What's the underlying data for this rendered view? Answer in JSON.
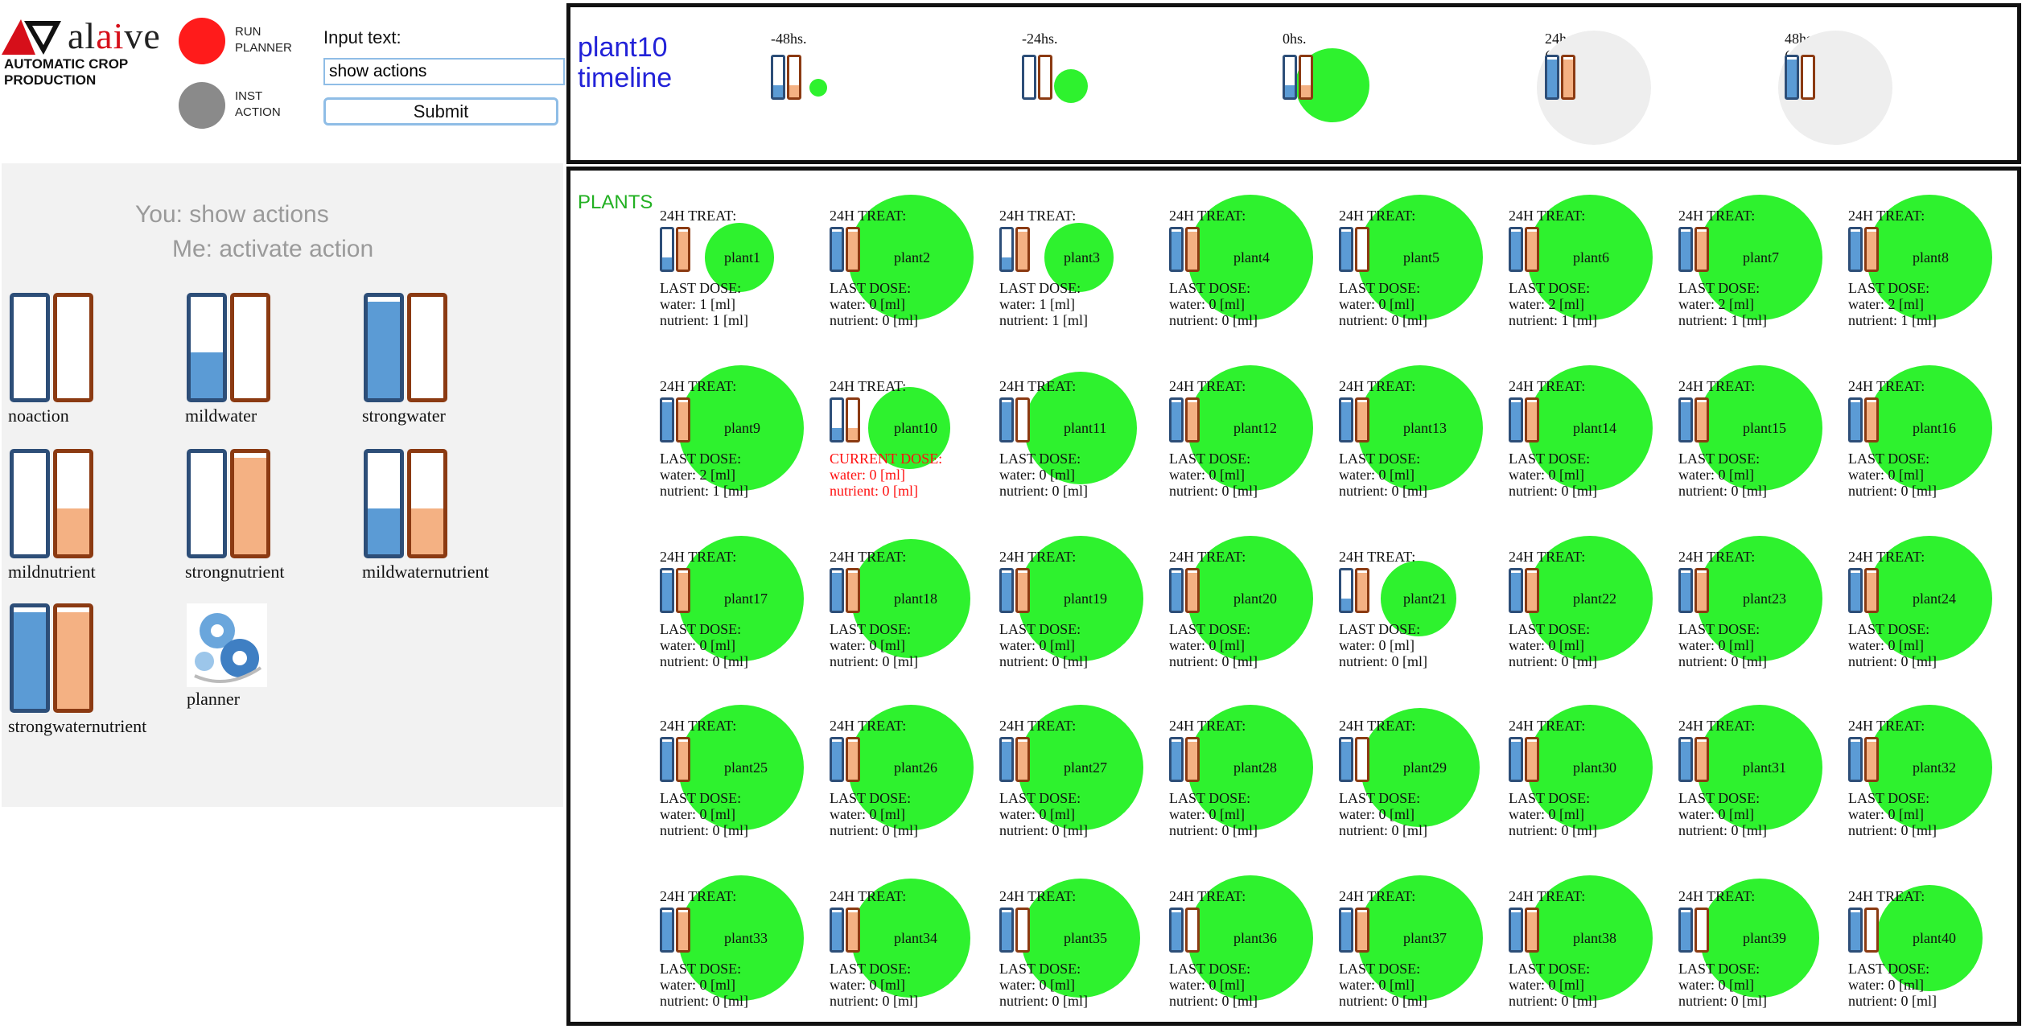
{
  "header": {
    "logo_text_a": "al",
    "logo_text_b": "ai",
    "logo_text_c": "ve",
    "subtitle_line1": "AUTOMATIC CROP",
    "subtitle_line2": "PRODUCTION",
    "run_planner_line1": "RUN",
    "run_planner_line2": "PLANNER",
    "inst_action_line1": "INST",
    "inst_action_line2": "ACTION",
    "input_label": "Input text:",
    "input_value": "show actions",
    "submit_label": "Submit"
  },
  "chat": {
    "you": "You: show actions",
    "me": "Me: activate action"
  },
  "colors": {
    "water": "#5b9bd5",
    "water_border": "#2d4e78",
    "nutrient": "#f4b183",
    "nutrient_border": "#8b3a12",
    "plant": "#2ef22e",
    "plan_circle": "#eeeeee",
    "run": "#ff1b1b",
    "inst": "#8a8a8a"
  },
  "actions": [
    {
      "label": "noaction",
      "water": 0,
      "nutrient": 0,
      "icon": "dual-gauge-icon"
    },
    {
      "label": "mildwater",
      "water": 0.45,
      "nutrient": 0,
      "icon": "dual-gauge-icon"
    },
    {
      "label": "strongwater",
      "water": 0.95,
      "nutrient": 0,
      "icon": "dual-gauge-icon"
    },
    {
      "label": "mildnutrient",
      "water": 0,
      "nutrient": 0.45,
      "icon": "dual-gauge-icon"
    },
    {
      "label": "strongnutrient",
      "water": 0,
      "nutrient": 0.95,
      "icon": "dual-gauge-icon"
    },
    {
      "label": "mildwaternutrient",
      "water": 0.45,
      "nutrient": 0.45,
      "icon": "dual-gauge-icon"
    },
    {
      "label": "strongwaternutrient",
      "water": 0.95,
      "nutrient": 0.95,
      "icon": "dual-gauge-icon"
    },
    {
      "label": "planner",
      "icon": "gears-icon"
    }
  ],
  "timeline": {
    "title_line1": "plant10",
    "title_line2": "timeline",
    "entries": [
      {
        "label": "-48hs.",
        "water": 0.3,
        "nutrient": 0.3,
        "size": 0.15,
        "plan": false
      },
      {
        "label": "-24hs.",
        "water": 0,
        "nutrient": 0,
        "size": 0.3,
        "plan": false
      },
      {
        "label": "0hs.",
        "water": 0.3,
        "nutrient": 0.3,
        "size": 0.65,
        "plan": false
      },
      {
        "label": "24hs. (plan)",
        "water": 0.95,
        "nutrient": 0.95,
        "size": 1.0,
        "plan": true
      },
      {
        "label": "48hs. (plan)",
        "water": 0.95,
        "nutrient": 0,
        "size": 1.0,
        "plan": true
      }
    ]
  },
  "plants_section": {
    "title": "PLANTS",
    "treat_label": "24H TREAT:",
    "last_dose_label": "LAST DOSE:",
    "current_dose_label": "CURRENT DOSE:",
    "water_prefix": "water: ",
    "nutrient_prefix": "nutrient: ",
    "unit": " [ml]"
  },
  "plants": [
    {
      "name": "plant1",
      "water": 1,
      "nutrient": 1,
      "treat_water": 0.3,
      "treat_nutrient": 0.95,
      "size": 0.55
    },
    {
      "name": "plant2",
      "water": 0,
      "nutrient": 0,
      "treat_water": 0.95,
      "treat_nutrient": 0.95,
      "size": 1.0
    },
    {
      "name": "plant3",
      "water": 1,
      "nutrient": 1,
      "treat_water": 0.3,
      "treat_nutrient": 0.95,
      "size": 0.55
    },
    {
      "name": "plant4",
      "water": 0,
      "nutrient": 0,
      "treat_water": 0.95,
      "treat_nutrient": 0.95,
      "size": 1.0
    },
    {
      "name": "plant5",
      "water": 0,
      "nutrient": 0,
      "treat_water": 0.95,
      "treat_nutrient": 0,
      "size": 1.0
    },
    {
      "name": "plant6",
      "water": 2,
      "nutrient": 1,
      "treat_water": 0.95,
      "treat_nutrient": 0.95,
      "size": 1.0
    },
    {
      "name": "plant7",
      "water": 2,
      "nutrient": 1,
      "treat_water": 0.95,
      "treat_nutrient": 0.95,
      "size": 1.0
    },
    {
      "name": "plant8",
      "water": 2,
      "nutrient": 1,
      "treat_water": 0.95,
      "treat_nutrient": 0.95,
      "size": 1.0
    },
    {
      "name": "plant9",
      "water": 2,
      "nutrient": 1,
      "treat_water": 0.95,
      "treat_nutrient": 0.95,
      "size": 1.0
    },
    {
      "name": "plant10",
      "water": 0,
      "nutrient": 0,
      "treat_water": 0.3,
      "treat_nutrient": 0.3,
      "size": 0.65,
      "current": true
    },
    {
      "name": "plant11",
      "water": 0,
      "nutrient": 0,
      "treat_water": 0.95,
      "treat_nutrient": 0,
      "size": 0.9
    },
    {
      "name": "plant12",
      "water": 0,
      "nutrient": 0,
      "treat_water": 0.95,
      "treat_nutrient": 0.95,
      "size": 1.0
    },
    {
      "name": "plant13",
      "water": 0,
      "nutrient": 0,
      "treat_water": 0.95,
      "treat_nutrient": 0.95,
      "size": 1.0
    },
    {
      "name": "plant14",
      "water": 0,
      "nutrient": 0,
      "treat_water": 0.95,
      "treat_nutrient": 0.95,
      "size": 1.0
    },
    {
      "name": "plant15",
      "water": 0,
      "nutrient": 0,
      "treat_water": 0.95,
      "treat_nutrient": 0.95,
      "size": 1.0
    },
    {
      "name": "plant16",
      "water": 0,
      "nutrient": 0,
      "treat_water": 0.95,
      "treat_nutrient": 0.95,
      "size": 1.0
    },
    {
      "name": "plant17",
      "water": 0,
      "nutrient": 0,
      "treat_water": 0.95,
      "treat_nutrient": 0.95,
      "size": 1.0
    },
    {
      "name": "plant18",
      "water": 0,
      "nutrient": 0,
      "treat_water": 0.95,
      "treat_nutrient": 0.95,
      "size": 0.95
    },
    {
      "name": "plant19",
      "water": 0,
      "nutrient": 0,
      "treat_water": 0.95,
      "treat_nutrient": 0.95,
      "size": 1.0
    },
    {
      "name": "plant20",
      "water": 0,
      "nutrient": 0,
      "treat_water": 0.95,
      "treat_nutrient": 0.95,
      "size": 1.0
    },
    {
      "name": "plant21",
      "water": 0,
      "nutrient": 0,
      "treat_water": 0.3,
      "treat_nutrient": 0.95,
      "size": 0.6
    },
    {
      "name": "plant22",
      "water": 0,
      "nutrient": 0,
      "treat_water": 0.95,
      "treat_nutrient": 0.95,
      "size": 1.0
    },
    {
      "name": "plant23",
      "water": 0,
      "nutrient": 0,
      "treat_water": 0.95,
      "treat_nutrient": 0.95,
      "size": 1.0
    },
    {
      "name": "plant24",
      "water": 0,
      "nutrient": 0,
      "treat_water": 0.95,
      "treat_nutrient": 0.95,
      "size": 1.0
    },
    {
      "name": "plant25",
      "water": 0,
      "nutrient": 0,
      "treat_water": 0.95,
      "treat_nutrient": 0.95,
      "size": 1.0
    },
    {
      "name": "plant26",
      "water": 0,
      "nutrient": 0,
      "treat_water": 0.95,
      "treat_nutrient": 0.95,
      "size": 1.0
    },
    {
      "name": "plant27",
      "water": 0,
      "nutrient": 0,
      "treat_water": 0.95,
      "treat_nutrient": 0.95,
      "size": 1.0
    },
    {
      "name": "plant28",
      "water": 0,
      "nutrient": 0,
      "treat_water": 0.95,
      "treat_nutrient": 0.95,
      "size": 1.0
    },
    {
      "name": "plant29",
      "water": 0,
      "nutrient": 0,
      "treat_water": 0.95,
      "treat_nutrient": 0,
      "size": 0.95
    },
    {
      "name": "plant30",
      "water": 0,
      "nutrient": 0,
      "treat_water": 0.95,
      "treat_nutrient": 0.95,
      "size": 1.0
    },
    {
      "name": "plant31",
      "water": 0,
      "nutrient": 0,
      "treat_water": 0.95,
      "treat_nutrient": 0.95,
      "size": 1.0
    },
    {
      "name": "plant32",
      "water": 0,
      "nutrient": 0,
      "treat_water": 0.95,
      "treat_nutrient": 0.95,
      "size": 1.0
    },
    {
      "name": "plant33",
      "water": 0,
      "nutrient": 0,
      "treat_water": 0.95,
      "treat_nutrient": 0.95,
      "size": 1.0
    },
    {
      "name": "plant34",
      "water": 0,
      "nutrient": 0,
      "treat_water": 0.95,
      "treat_nutrient": 0.95,
      "size": 0.95
    },
    {
      "name": "plant35",
      "water": 0,
      "nutrient": 0,
      "treat_water": 0.95,
      "treat_nutrient": 0,
      "size": 0.95
    },
    {
      "name": "plant36",
      "water": 0,
      "nutrient": 0,
      "treat_water": 0.95,
      "treat_nutrient": 0,
      "size": 1.0
    },
    {
      "name": "plant37",
      "water": 0,
      "nutrient": 0,
      "treat_water": 0.95,
      "treat_nutrient": 0.95,
      "size": 1.0
    },
    {
      "name": "plant38",
      "water": 0,
      "nutrient": 0,
      "treat_water": 0.95,
      "treat_nutrient": 0.95,
      "size": 1.0
    },
    {
      "name": "plant39",
      "water": 0,
      "nutrient": 0,
      "treat_water": 0.95,
      "treat_nutrient": 0,
      "size": 0.95
    },
    {
      "name": "plant40",
      "water": 0,
      "nutrient": 0,
      "treat_water": 0.95,
      "treat_nutrient": 0,
      "size": 0.85
    }
  ]
}
